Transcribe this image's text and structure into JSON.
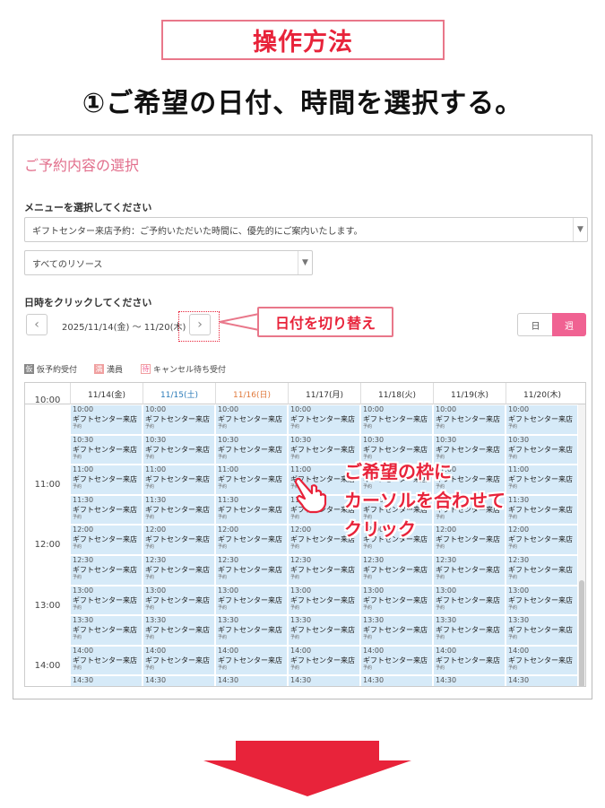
{
  "banner": "操作方法",
  "heading": "①ご希望の日付、時間を選択する。",
  "panel": {
    "title": "ご予約内容の選択",
    "menu_label": "メニューを選択してください",
    "menu_value": "ギフトセンター来店予約：ご予約いただいた時間に、優先的にご案内いたします。",
    "resource_value": "すべてのリソース",
    "date_label": "日時をクリックしてください",
    "date_range": "2025/11/14(金) ～ 11/20(木)",
    "prev_icon": "chevron-left-icon",
    "next_icon": "chevron-right-icon",
    "view_day": "日",
    "view_week": "週",
    "accent_color": "#f06292"
  },
  "callout": "日付を切り替え",
  "legend": [
    {
      "badge": "仮",
      "label": "仮予約受付",
      "color": "#888888"
    },
    {
      "badge": "満",
      "label": "満員",
      "color": "#f0a0a0"
    },
    {
      "badge": "待",
      "label": "キャンセル待ち受付",
      "color": "#ffffff"
    }
  ],
  "calendar": {
    "days": [
      {
        "label": "11/14(金)",
        "color": "#333333"
      },
      {
        "label": "11/15(土)",
        "color": "#2a7ab8"
      },
      {
        "label": "11/16(日)",
        "color": "#e07a3c"
      },
      {
        "label": "11/17(月)",
        "color": "#333333"
      },
      {
        "label": "11/18(火)",
        "color": "#333333"
      },
      {
        "label": "11/19(水)",
        "color": "#333333"
      },
      {
        "label": "11/20(木)",
        "color": "#333333"
      }
    ],
    "hours": [
      "10:00",
      "11:00",
      "12:00",
      "13:00",
      "14:00"
    ],
    "slots": [
      "10:00",
      "10:30",
      "11:00",
      "11:30",
      "12:00",
      "12:30",
      "13:00",
      "13:30",
      "14:00",
      "14:30"
    ],
    "slot_text": "ギフトセンター来店",
    "slot_sub": "予約",
    "slot_color": "#d6eaf8"
  },
  "overlay": {
    "line1": "ご希望の枠に",
    "line2": "カーソルを合わせて",
    "line3": "クリック",
    "hand_icon": "pointing-hand-icon"
  },
  "arrow_icon": "down-arrow-icon"
}
